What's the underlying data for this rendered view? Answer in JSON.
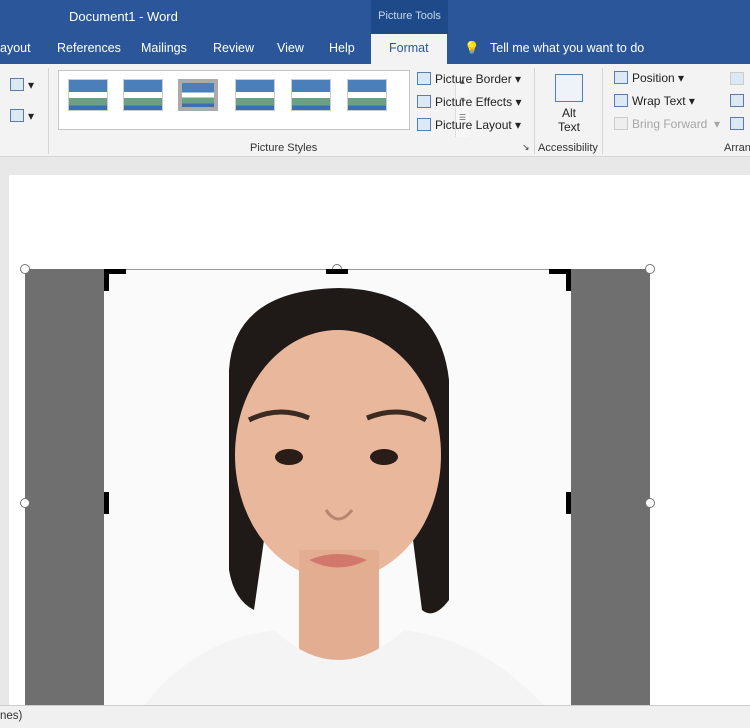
{
  "title": "Document1  -  Word",
  "context_tab_group": "Picture Tools",
  "tabs": [
    "ayout",
    "References",
    "Mailings",
    "Review",
    "View",
    "Help",
    "Format"
  ],
  "tell_me": "Tell me what you want to do",
  "ribbon": {
    "picture_border": "Picture Border",
    "picture_effects": "Picture Effects",
    "picture_layout": "Picture Layout",
    "picture_styles_label": "Picture Styles",
    "alt_text": [
      "Alt",
      "Text"
    ],
    "accessibility_label": "Accessibility",
    "position": "Position",
    "wrap_text": "Wrap Text",
    "bring_forward": "Bring Forward",
    "arrange_label": "Arran"
  },
  "status": "nes)",
  "colors": {
    "title_bar": "#2b579a",
    "crop_area": "#6f6f6f"
  }
}
